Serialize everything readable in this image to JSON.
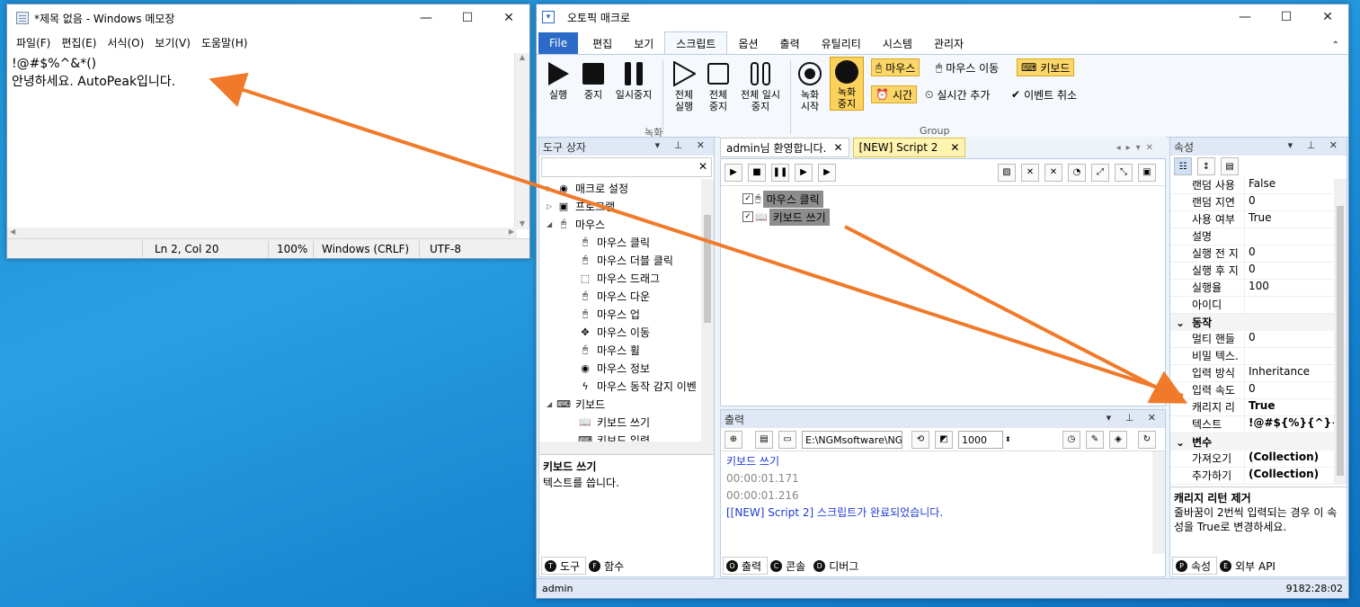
{
  "notepad": {
    "title": "*제목 없음 - Windows 메모장",
    "menu": [
      "파일(F)",
      "편집(E)",
      "서식(O)",
      "보기(V)",
      "도움말(H)"
    ],
    "lines": [
      "!@#$%^&*()",
      "안녕하세요. AutoPeak입니다."
    ],
    "status": {
      "pos": "Ln 2, Col 20",
      "zoom": "100%",
      "eol": "Windows (CRLF)",
      "enc": "UTF-8"
    }
  },
  "app": {
    "title": "오토픽 매크로",
    "tabs": [
      "File",
      "편집",
      "보기",
      "스크립트",
      "옵션",
      "출력",
      "유틸리티",
      "시스템",
      "관리자"
    ],
    "ribbon": {
      "play": "실행",
      "stop": "중지",
      "pause": "일시중지",
      "all_run": "전체 실행",
      "all_stop": "전체 중지",
      "all_pause": "전체 일시중지",
      "rec_start": "녹화 시작",
      "rec_stop": "녹화 중지",
      "group_rec": "녹화",
      "group_group": "Group",
      "chip_mouse": "마우스",
      "chip_mouse_move": "마우스 이동",
      "chip_keyboard": "키보드",
      "chip_time": "시간",
      "chip_realtime": "실시간 추가",
      "chip_event_cancel": "이벤트 취소"
    },
    "toolbox": {
      "title": "도구 상자",
      "items": [
        {
          "label": "매크로 설정",
          "level": 0,
          "exp": "▷"
        },
        {
          "label": "프로그램",
          "level": 0,
          "exp": "▷"
        },
        {
          "label": "마우스",
          "level": 0,
          "exp": "◢"
        },
        {
          "label": "마우스 클릭",
          "level": 1
        },
        {
          "label": "마우스 더블 클릭",
          "level": 1
        },
        {
          "label": "마우스 드래그",
          "level": 1
        },
        {
          "label": "마우스 다운",
          "level": 1
        },
        {
          "label": "마우스 업",
          "level": 1
        },
        {
          "label": "마우스 이동",
          "level": 1
        },
        {
          "label": "마우스 휠",
          "level": 1
        },
        {
          "label": "마우스 정보",
          "level": 1
        },
        {
          "label": "마우스 동작 감지 이벤",
          "level": 1
        },
        {
          "label": "키보드",
          "level": 0,
          "exp": "◢"
        },
        {
          "label": "키보드 쓰기",
          "level": 1
        },
        {
          "label": "키보드 입력",
          "level": 1
        }
      ],
      "desc_title": "키보드 쓰기",
      "desc_body": "텍스트를 씁니다.",
      "tabs": [
        "도구",
        "함수"
      ]
    },
    "doc_tabs": [
      "admin님 환영합니다.",
      "[NEW] Script 2"
    ],
    "script_items": [
      "마우스 클릭",
      "키보드 쓰기"
    ],
    "output": {
      "title": "출력",
      "path": "E:\\NGMsoftware\\NG",
      "delay": "1000",
      "lines": [
        "키보드 쓰기",
        "00:00:01.171",
        "00:00:01.216",
        "[[NEW] Script 2] 스크립트가 완료되었습니다."
      ],
      "tabs": [
        "출력",
        "콘솔",
        "디버그"
      ]
    },
    "props": {
      "title": "속성",
      "rows_top": [
        [
          "랜덤 사용",
          "False"
        ],
        [
          "랜덤 지연",
          "0"
        ],
        [
          "사용 여부",
          "True"
        ],
        [
          "설명",
          ""
        ],
        [
          "실행 전 지",
          "0"
        ],
        [
          "실행 후 지",
          "0"
        ],
        [
          "실행율",
          "100"
        ],
        [
          "아이디",
          ""
        ]
      ],
      "cat_action": "동작",
      "rows_action": [
        [
          "멀티 핸들",
          "0"
        ],
        [
          "비밀 텍스.",
          ""
        ],
        [
          "입력 방식",
          "Inheritance"
        ],
        [
          "입력 속도",
          "0"
        ],
        [
          "캐리지 리",
          "True"
        ],
        [
          "텍스트",
          "!@#${%}{^}{&}*(("
        ]
      ],
      "cat_var": "변수",
      "rows_var": [
        [
          "가져오기",
          "(Collection)"
        ],
        [
          "추가하기",
          "(Collection)"
        ]
      ],
      "desc_title": "캐리지 리턴 제거",
      "desc_body": "줄바꿈이 2번씩 입력되는 경우 이 속성을 True로 변경하세요.",
      "tabs": [
        "속성",
        "외부 API"
      ]
    },
    "status_user": "admin",
    "status_right": "9182:28:02"
  }
}
